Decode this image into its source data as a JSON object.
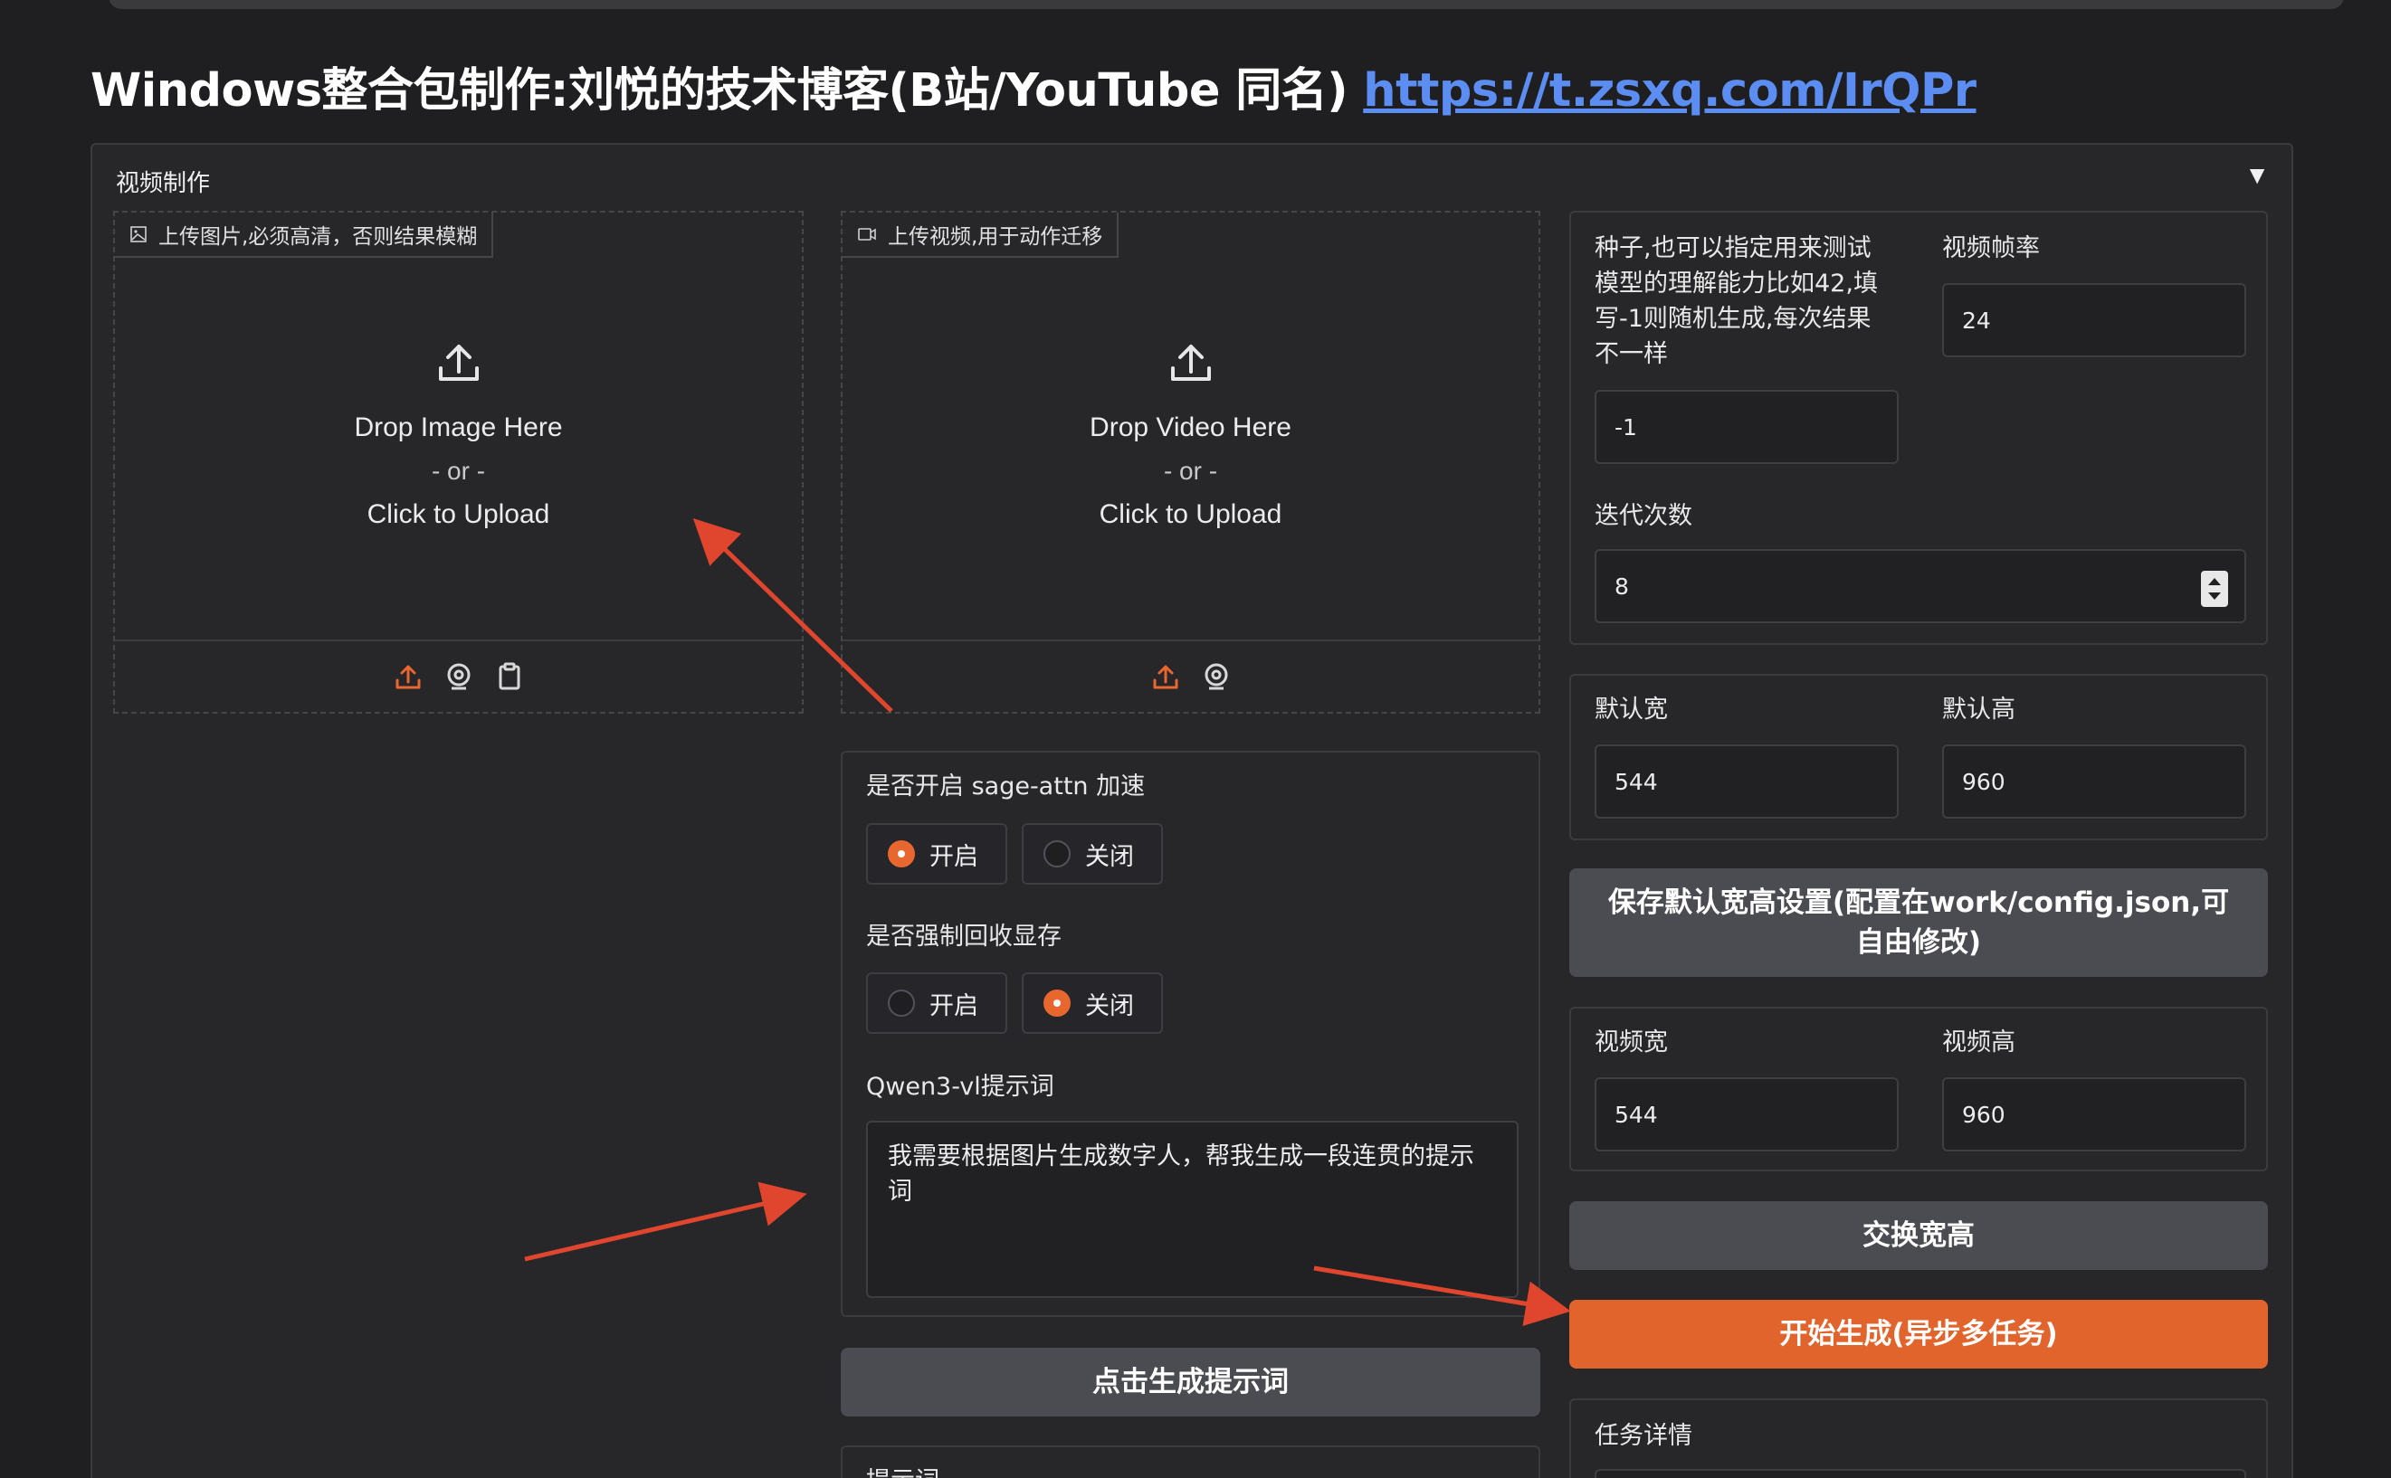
{
  "header": {
    "title": "Windows整合包制作:刘悦的技术博客(B站/YouTube 同名)",
    "link": "https://t.zsxq.com/IrQPr"
  },
  "accordion": {
    "label": "视频制作",
    "toggle_icon": "triangle-down-icon"
  },
  "image_upload": {
    "tag": "上传图片,必须高清，否则结果模糊",
    "drop": "Drop Image Here",
    "or": "- or -",
    "click": "Click to Upload"
  },
  "video_upload": {
    "tag": "上传视频,用于动作迁移",
    "drop": "Drop Video Here",
    "or": "- or -",
    "click": "Click to Upload"
  },
  "options": {
    "sage_label": "是否开启 sage-attn 加速",
    "sage_on": "开启",
    "sage_off": "关闭",
    "sage_selected": "开启",
    "vram_label": "是否强制回收显存",
    "vram_on": "开启",
    "vram_off": "关闭",
    "vram_selected": "关闭",
    "qwen_label": "Qwen3-vl提示词",
    "qwen_value": "我需要根据图片生成数字人，帮我生成一段连贯的提示词",
    "gen_prompt_button": "点击生成提示词",
    "prompt_label_partial": "提示词"
  },
  "settings": {
    "seed_label": "种子,也可以指定用来测试模型的理解能力比如42,填写-1则随机生成,每次结果不一样",
    "seed_value": "-1",
    "fps_label": "视频帧率",
    "fps_value": "24",
    "steps_label": "迭代次数",
    "steps_value": "8",
    "default_width_label": "默认宽",
    "default_width_value": "544",
    "default_height_label": "默认高",
    "default_height_value": "960",
    "save_button": "保存默认宽高设置(配置在work/config.json,可自由修改)",
    "video_width_label": "视频宽",
    "video_width_value": "544",
    "video_height_label": "视频高",
    "video_height_value": "960",
    "swap_button": "交换宽高",
    "start_button": "开始生成(异步多任务)",
    "task_label": "任务详情"
  },
  "colors": {
    "accent": "#e1642c",
    "annotation_arrow": "#e0452d",
    "link": "#5b8df2"
  }
}
